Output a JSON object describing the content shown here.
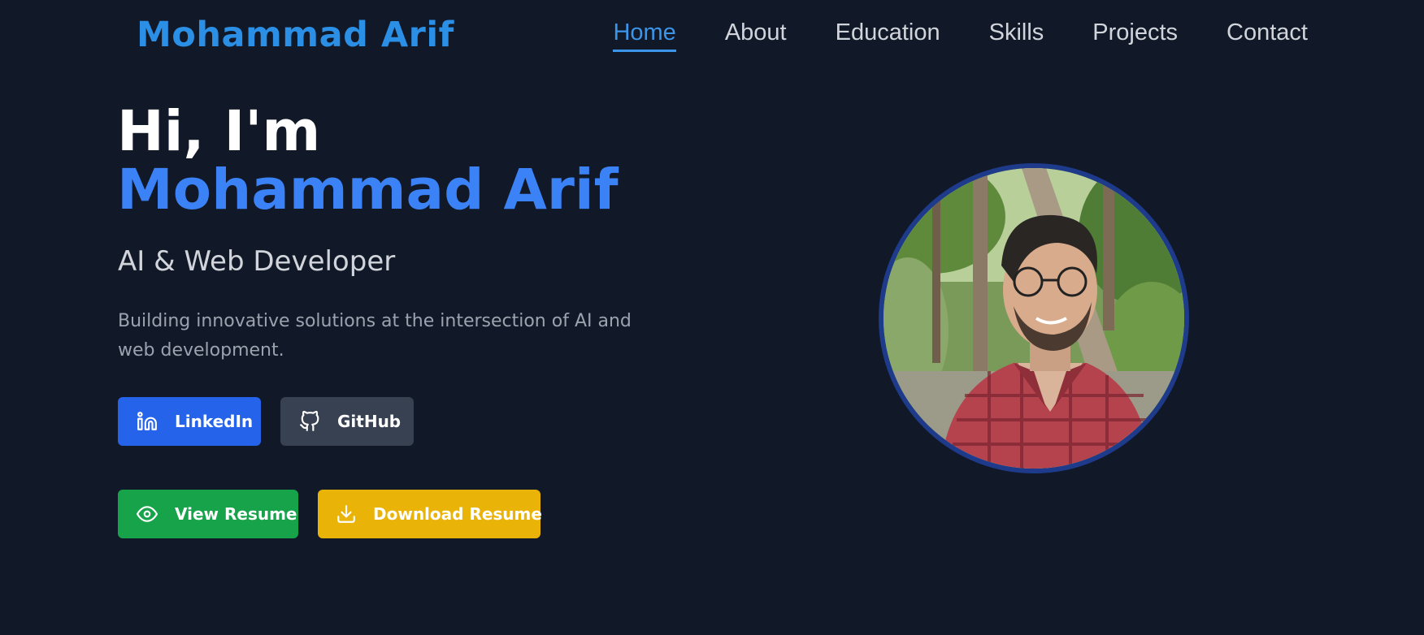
{
  "brand": {
    "name": "Mohammad Arif"
  },
  "nav": {
    "items": [
      {
        "label": "Home",
        "active": true
      },
      {
        "label": "About"
      },
      {
        "label": "Education"
      },
      {
        "label": "Skills"
      },
      {
        "label": "Projects"
      },
      {
        "label": "Contact"
      }
    ]
  },
  "hero": {
    "greeting": "Hi, I'm ",
    "name": "Mohammad Arif",
    "subtitle": "AI & Web Developer",
    "description": "Building innovative solutions at the intersection of AI and web development."
  },
  "buttons": {
    "linkedin": {
      "label": "LinkedIn",
      "icon": "linkedin-icon"
    },
    "github": {
      "label": "GitHub",
      "icon": "github-icon"
    },
    "view_resume": {
      "label": "View Resume",
      "icon": "eye-icon"
    },
    "download_resume": {
      "label": "Download Resume",
      "icon": "download-icon"
    }
  },
  "colors": {
    "background": "#111827",
    "accent": "#3b82f6",
    "linkedin": "#2563eb",
    "github": "#374151",
    "view": "#16a34a",
    "download": "#eab308"
  }
}
